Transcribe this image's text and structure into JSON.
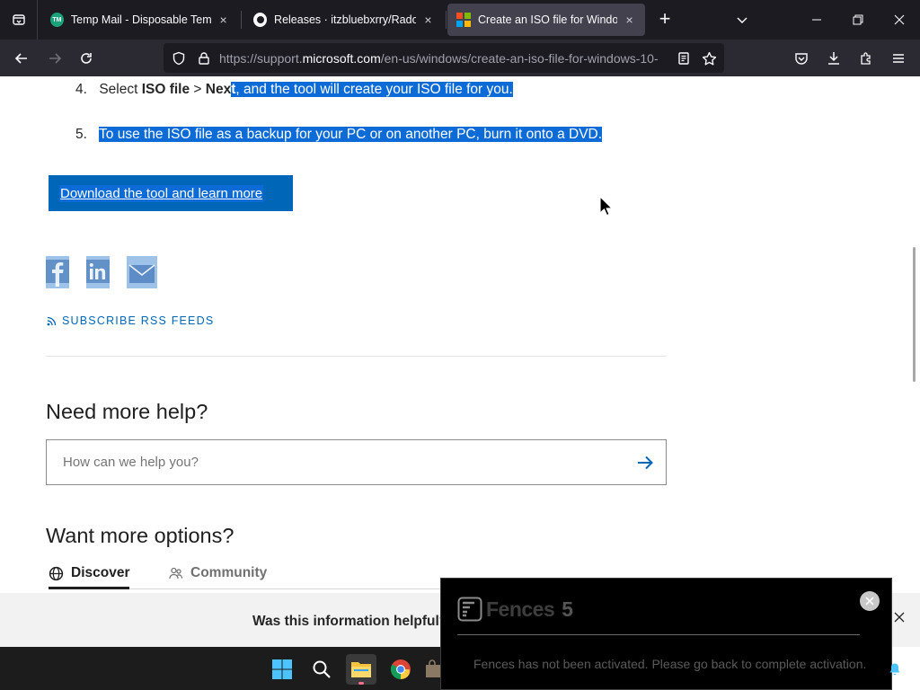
{
  "browser": {
    "tabs": [
      {
        "title": "Temp Mail - Disposable Temporary Email",
        "icon": "temp-mail-favicon"
      },
      {
        "title": "Releases · itzbluebxrry/Radon-Browser",
        "icon": "github-favicon"
      },
      {
        "title": "Create an ISO file for Windows",
        "icon": "microsoft-favicon",
        "active": true
      }
    ],
    "url_prefix": "https://support.",
    "url_domain": "microsoft.com",
    "url_path": "/en-us/windows/create-an-iso-file-for-windows-10-",
    "close_glyph": "×",
    "newtab_glyph": "+"
  },
  "page": {
    "steps": [
      {
        "num": "4.",
        "pre": "Select ",
        "b1": "ISO file",
        "mid": " > ",
        "b2a": "Nex",
        "b2b": "t",
        "rest": ", and the tool will create your ISO file for you."
      },
      {
        "num": "5.",
        "text": "To use the ISO file as a backup for your PC or on another PC, burn it onto a DVD."
      }
    ],
    "download_button": "Download the tool and learn more",
    "social_icons": [
      "facebook-icon",
      "linkedin-icon",
      "email-icon"
    ],
    "rss_link": "SUBSCRIBE RSS FEEDS",
    "help_heading": "Need more help?",
    "search_placeholder": "How can we help you?",
    "options_heading": "Want more options?",
    "option_tabs": [
      {
        "label": "Discover",
        "active": true
      },
      {
        "label": "Community",
        "active": false
      }
    ],
    "feedback_question": "Was this information helpful?"
  },
  "fences": {
    "name": "Fences",
    "version": "5",
    "message": "Fences has not been activated. Please go back to complete activation."
  },
  "colors": {
    "accent": "#0067b8",
    "selection": "#0d6bd7",
    "chrome_dark": "#1c1b22"
  }
}
